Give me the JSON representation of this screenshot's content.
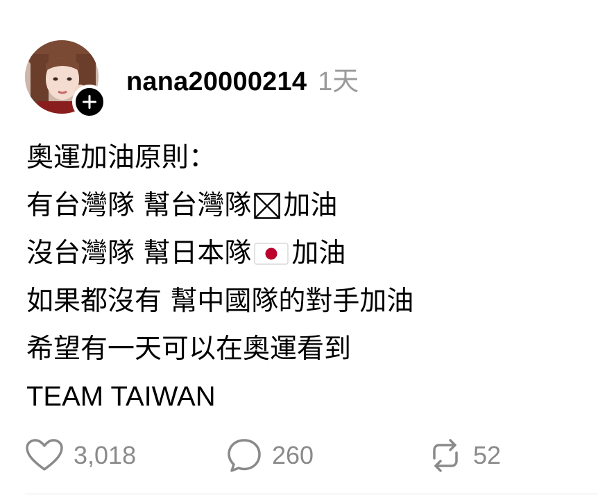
{
  "post": {
    "username": "nana20000214",
    "timestamp": "1天",
    "lines": [
      {
        "before": "奧運加油原則：",
        "flag": "",
        "after": ""
      },
      {
        "before": "有台灣隊 幫台灣隊",
        "flag": "taiwan-flag-placeholder-icon",
        "after": "加油"
      },
      {
        "before": "沒台灣隊 幫日本隊",
        "flag": "japan-flag-icon",
        "after": "加油"
      },
      {
        "before": "如果都沒有 幫中國隊的對手加油",
        "flag": "",
        "after": ""
      },
      {
        "before": "希望有一天可以在奧運看到",
        "flag": "",
        "after": ""
      },
      {
        "before": "TEAM TAIWAN",
        "flag": "",
        "after": ""
      }
    ]
  },
  "actions": {
    "likes": "3,018",
    "comments": "260",
    "reposts": "52"
  },
  "colors": {
    "text": "#000000",
    "muted": "#8a8a8a",
    "japan_red": "#bc002d"
  },
  "icons": {
    "like": "heart-icon",
    "comment": "speech-bubble-icon",
    "repost": "repost-arrows-icon",
    "follow": "plus-icon"
  }
}
